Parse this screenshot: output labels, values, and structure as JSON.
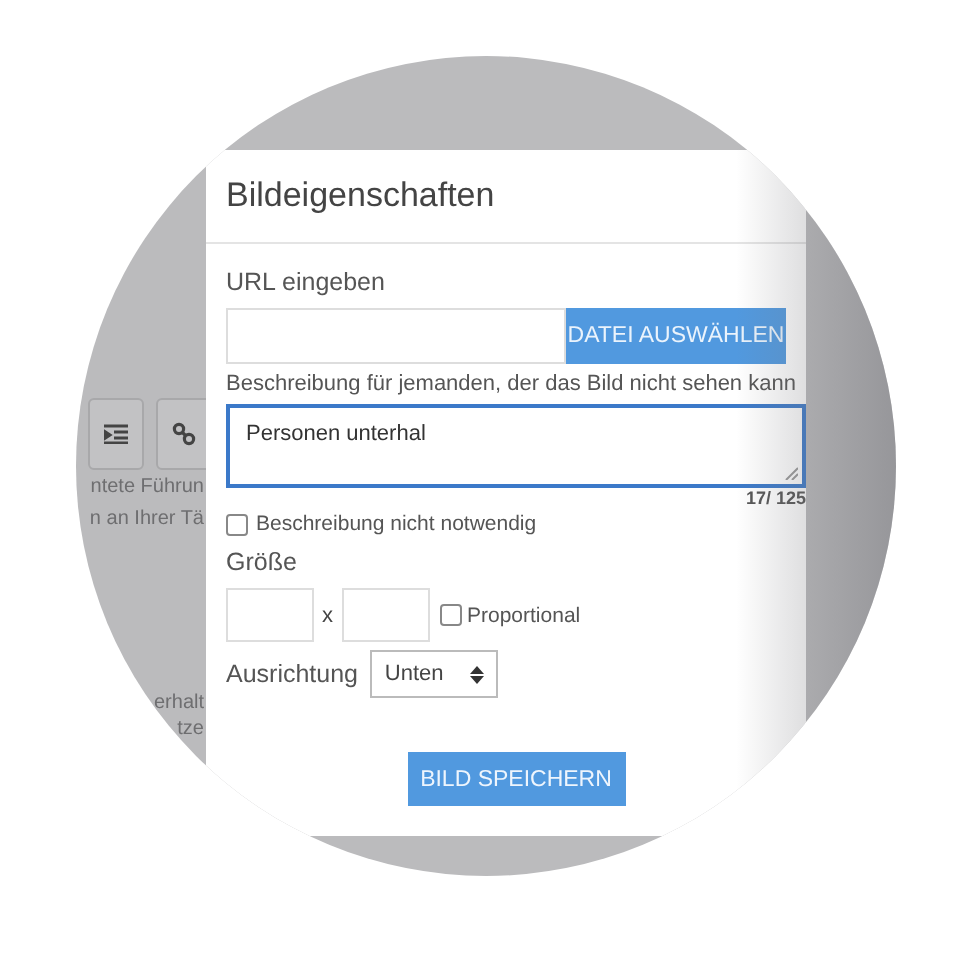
{
  "background": {
    "toolbar_buttons": [
      {
        "kind": "list"
      },
      {
        "kind": "link"
      }
    ],
    "text_fragments": [
      {
        "text": "ntete Führun"
      },
      {
        "text": "n an Ihrer Tä"
      },
      {
        "text": "erhalt"
      },
      {
        "text": "tze"
      }
    ]
  },
  "dialog": {
    "title": "Bildeigenschaften",
    "url_label": "URL eingeben",
    "file_button": "DATEI AUSWÄHLEN",
    "description_label": "Beschreibung für jemanden, der das Bild nicht sehen kann",
    "description_value": "Personen unterhal",
    "counter": "17/ 125",
    "not_needed": {
      "label": "Beschreibung nicht notwendig",
      "checked": false
    },
    "size_label": "Größe",
    "size_separator": "x",
    "proportional": {
      "label": "Proportional",
      "checked": false
    },
    "alignment": {
      "label": "Ausrichtung",
      "value": "Unten"
    },
    "save_button": "BILD SPEICHERN"
  }
}
